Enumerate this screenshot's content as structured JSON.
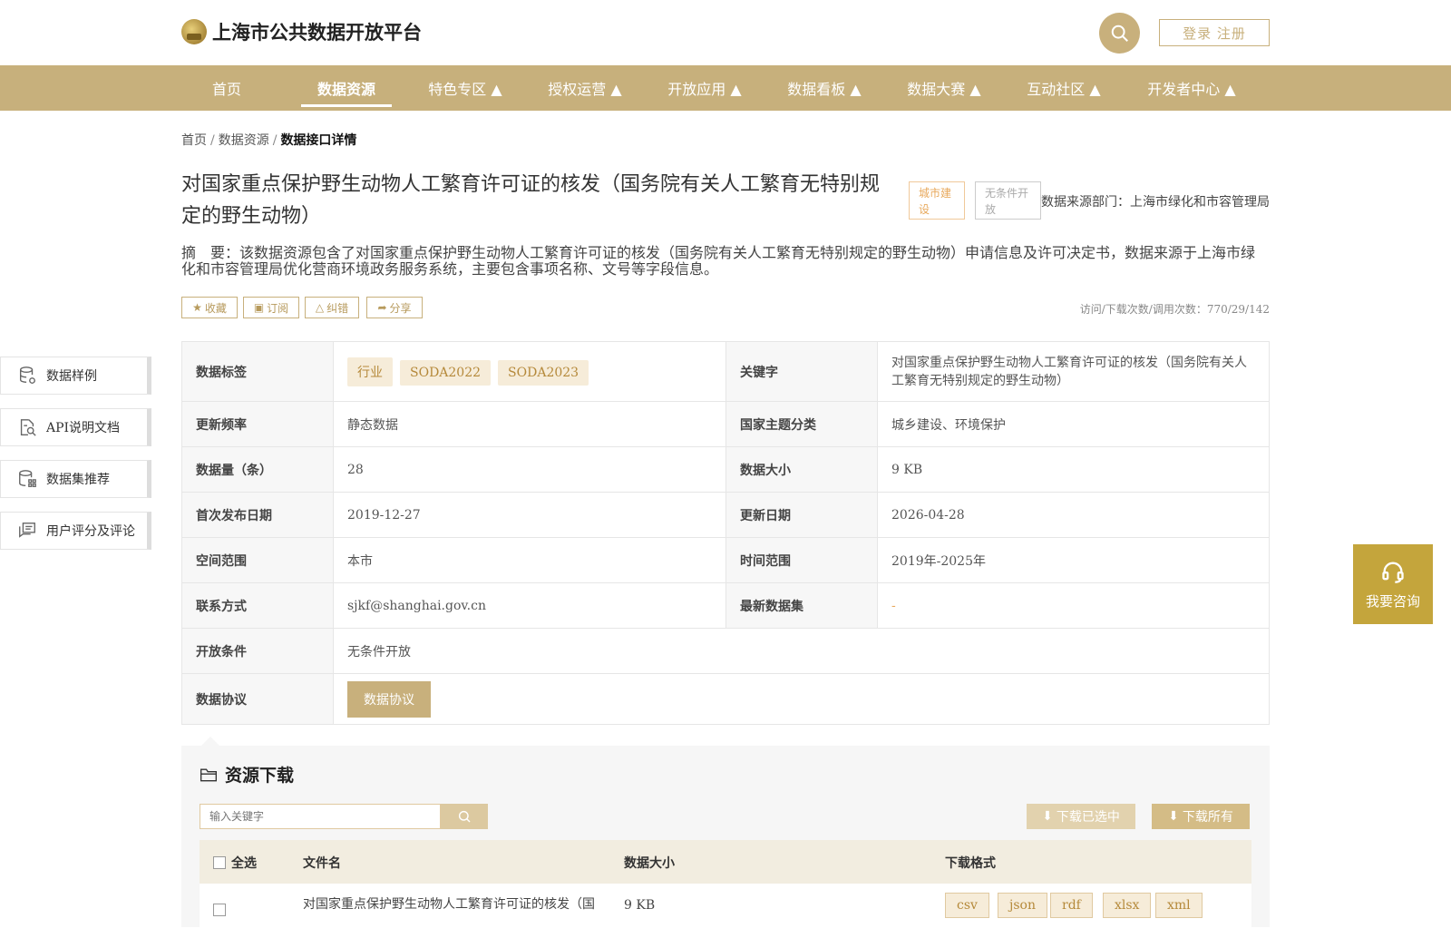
{
  "header": {
    "site_title": "上海市公共数据开放平台",
    "login_label": "登录 注册",
    "nav": [
      {
        "label": "首页"
      },
      {
        "label": "数据资源"
      },
      {
        "label": "特色专区 ▲"
      },
      {
        "label": "授权运营 ▲"
      },
      {
        "label": "开放应用 ▲"
      },
      {
        "label": "数据看板 ▲"
      },
      {
        "label": "数据大赛 ▲"
      },
      {
        "label": "互动社区 ▲"
      },
      {
        "label": "开发者中心 ▲"
      }
    ]
  },
  "breadcrumb": {
    "home": "首页",
    "section": "数据资源",
    "current": "数据接口详情",
    "sep": "/"
  },
  "detail": {
    "title": "对国家重点保护野生动物人工繁育许可证的核发（国务院有关人工繁育无特别规定的野生动物）",
    "tag_city": "城市建设",
    "tag_open": "无条件开放",
    "source_dept": "数据来源部门：上海市绿化和市容管理局",
    "abstract_label": "摘　要：",
    "abstract": "该数据资源包含了对国家重点保护野生动物人工繁育许可证的核发（国务院有关人工繁育无特别规定的野生动物）申请信息及许可决定书，数据来源于上海市绿化和市容管理局优化营商环境政务服务系统，主要包含事项名称、文号等字段信息。",
    "actions": {
      "favorite": "收藏",
      "subscribe": "订阅",
      "report": "纠错",
      "share": "分享"
    },
    "stats": "访问/下载次数/调用次数：770/29/142"
  },
  "side_nav": [
    {
      "label": "数据样例"
    },
    {
      "label": "API说明文档"
    },
    {
      "label": "数据集推荐"
    },
    {
      "label": "用户评分及评论"
    }
  ],
  "info": {
    "tags_label": "数据标签",
    "tags": [
      "行业",
      "SODA2022",
      "SODA2023"
    ],
    "keyword_label": "关键字",
    "keyword": "对国家重点保护野生动物人工繁育许可证的核发（国务院有关人工繁育无特别规定的野生动物）",
    "update_freq_label": "更新频率",
    "update_freq": "静态数据",
    "theme_label": "国家主题分类",
    "theme": "城乡建设、环境保护",
    "count_label": "数据量（条）",
    "count": "28",
    "size_label": "数据大小",
    "size": "9 KB",
    "first_pub_label": "首次发布日期",
    "first_pub": "2019-12-27",
    "update_date_label": "更新日期",
    "update_date": "2026-04-28",
    "space_label": "空间范围",
    "space": "本市",
    "time_label": "时间范围",
    "time": "2019年-2025年",
    "contact_label": "联系方式",
    "contact": "sjkf@shanghai.gov.cn",
    "latest_label": "最新数据集",
    "latest": "-",
    "open_cond_label": "开放条件",
    "open_cond": "无条件开放",
    "protocol_label": "数据协议",
    "protocol_btn": "数据协议"
  },
  "download": {
    "title": "资源下载",
    "placeholder": "输入关键字",
    "download_selected": "下载已选中",
    "download_all": "下载所有",
    "col_select_all": "全选",
    "col_filename": "文件名",
    "col_size": "数据大小",
    "col_format": "下载格式",
    "rows": [
      {
        "filename": "对国家重点保护野生动物人工繁育许可证的核发（国",
        "size": "9 KB",
        "formats": [
          "csv",
          "json",
          "rdf",
          "xlsx",
          "xml"
        ]
      }
    ]
  },
  "consult": {
    "label": "我要咨询"
  },
  "colors": {
    "brand": "#c7b07c",
    "accent": "#c4a53c",
    "chip_bg": "#f6ecd9"
  }
}
